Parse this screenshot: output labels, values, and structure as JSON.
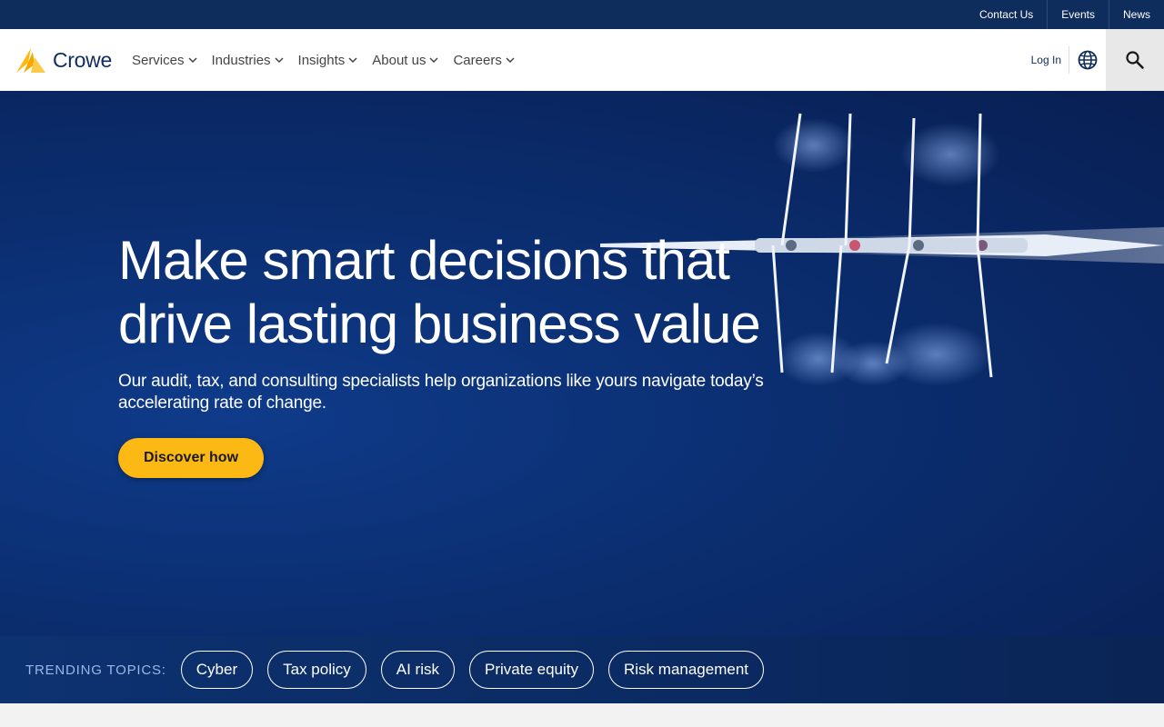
{
  "utility_links": [
    "Contact Us",
    "Events",
    "News"
  ],
  "logo": {
    "text": "Crowe",
    "brand_color": "#0f2d5c",
    "accent": "#fdb913"
  },
  "nav": {
    "items": [
      "Services",
      "Industries",
      "Insights",
      "About us",
      "Careers"
    ],
    "login": "Log In"
  },
  "icons": {
    "globe": "globe-icon",
    "search": "search-icon",
    "chevron": "chevron-down-icon"
  },
  "hero": {
    "title": "Make smart decisions that drive lasting business value",
    "subtitle": "Our audit, tax, and consulting specialists help organizations like yours navigate today’s accelerating rate of change.",
    "cta": "Discover how"
  },
  "trending": {
    "label": "TRENDING TOPICS:",
    "topics": [
      "Cyber",
      "Tax policy",
      "AI risk",
      "Private equity",
      "Risk management"
    ]
  }
}
